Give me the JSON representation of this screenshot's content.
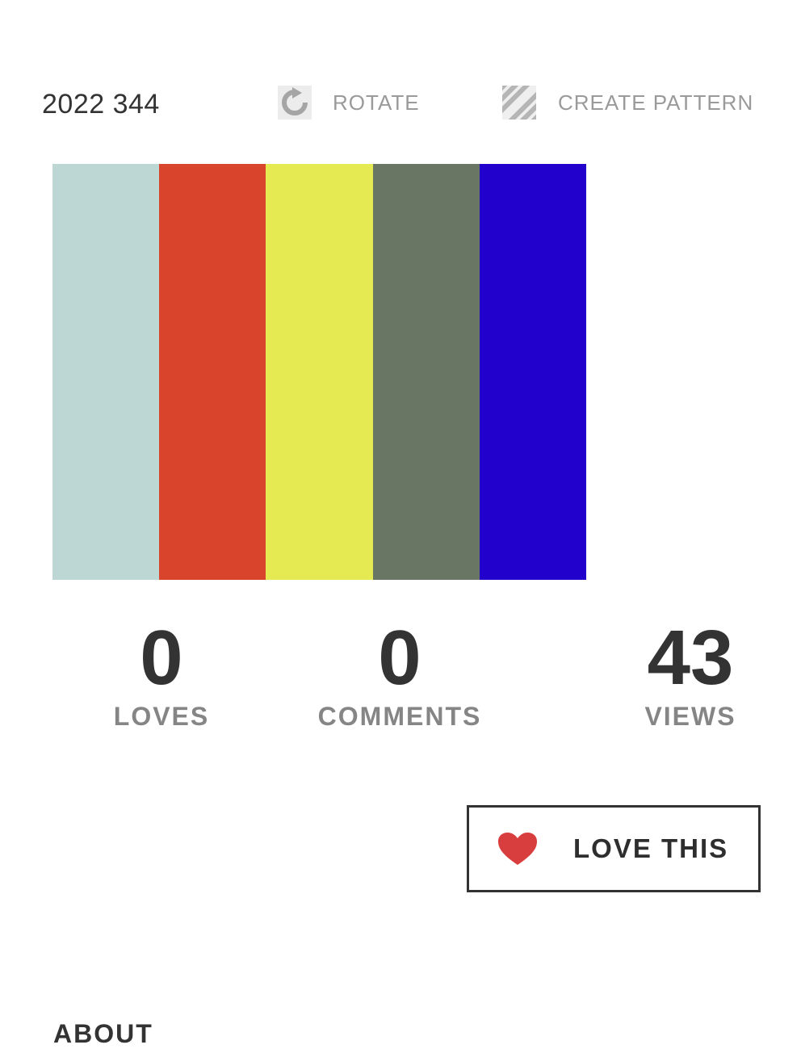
{
  "palette": {
    "title": "2022 344",
    "colors": [
      "#bdd8d4",
      "#d9452c",
      "#e5ea52",
      "#6a7664",
      "#2201cd"
    ]
  },
  "tools": {
    "rotate_label": "ROTATE",
    "rotate_icon": "rotate-icon",
    "pattern_label": "CREATE PATTERN",
    "pattern_icon": "stripes-pattern-icon"
  },
  "stats": {
    "loves": {
      "value": "0",
      "label": "LOVES"
    },
    "comments": {
      "value": "0",
      "label": "COMMENTS"
    },
    "views": {
      "value": "43",
      "label": "VIEWS"
    }
  },
  "love_button": {
    "label": "LOVE THIS",
    "icon": "heart-icon",
    "icon_color": "#d93e3e"
  },
  "section": {
    "heading": "ABOUT"
  }
}
